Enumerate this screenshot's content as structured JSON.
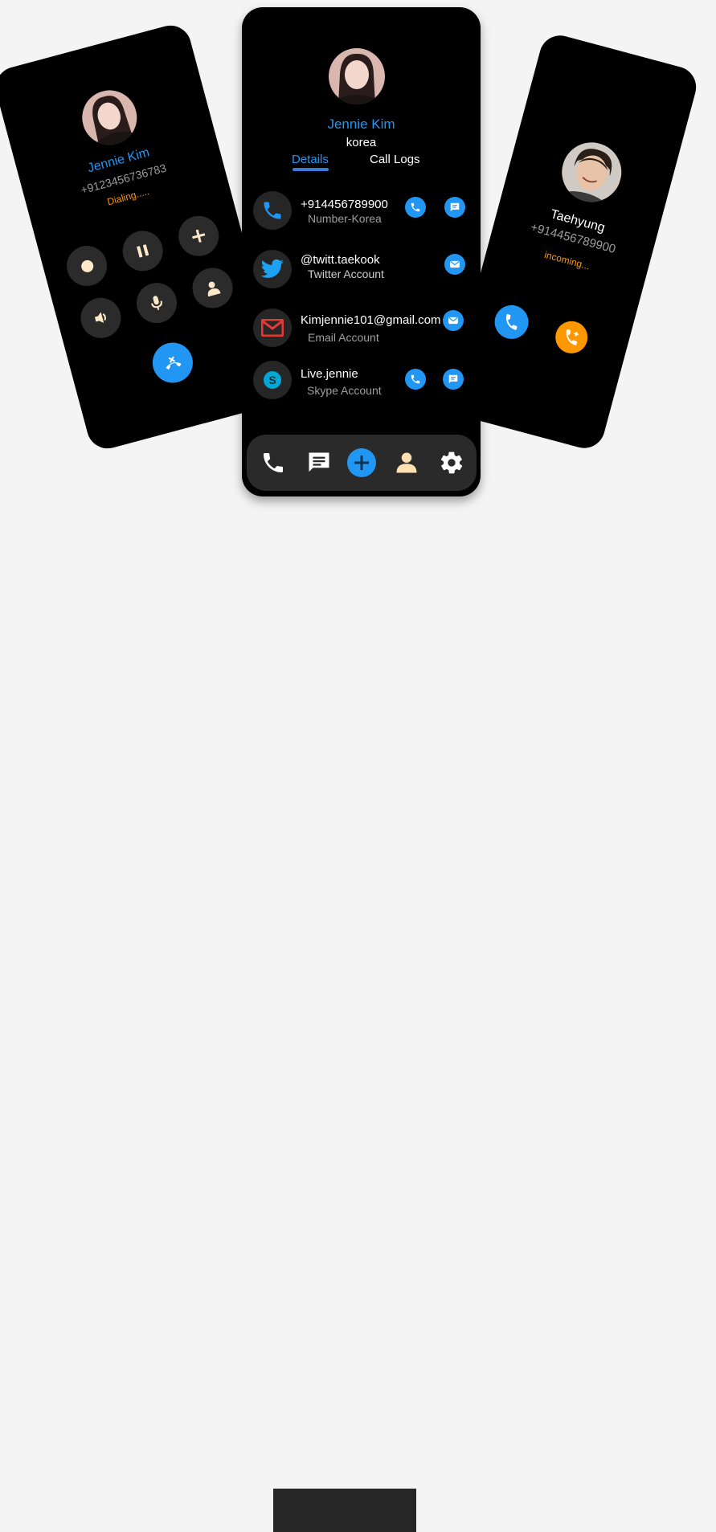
{
  "left_card": {
    "name": "Jennie Kim",
    "number": "+9123456736783",
    "status": "Dialing....."
  },
  "center_card": {
    "name": "Jennie Kim",
    "country": "korea",
    "tabs": [
      {
        "label": "Details",
        "active": true
      },
      {
        "label": "Call Logs",
        "active": false
      }
    ],
    "rows": [
      {
        "primary": "+914456789900",
        "secondary": "Number-Korea",
        "icon": "phone-icon"
      },
      {
        "primary": "@twitt.taekook",
        "secondary": "Twitter Account",
        "icon": "twitter-icon"
      },
      {
        "primary": "Kimjennie101@gmail.com",
        "secondary": "Email Account",
        "icon": "gmail-icon"
      },
      {
        "primary": "Live.jennie",
        "secondary": "Skype Account",
        "icon": "skype-icon"
      }
    ],
    "nav": [
      "phone-icon",
      "message-icon",
      "add-icon",
      "person-icon",
      "settings-icon"
    ]
  },
  "right_card": {
    "name": "Taehyung",
    "number": "+914456789900",
    "status": "incoming..."
  },
  "colors": {
    "accent": "#2196f3",
    "orange": "#ff9800",
    "background": "#f4f4f4",
    "card": "#000000"
  }
}
